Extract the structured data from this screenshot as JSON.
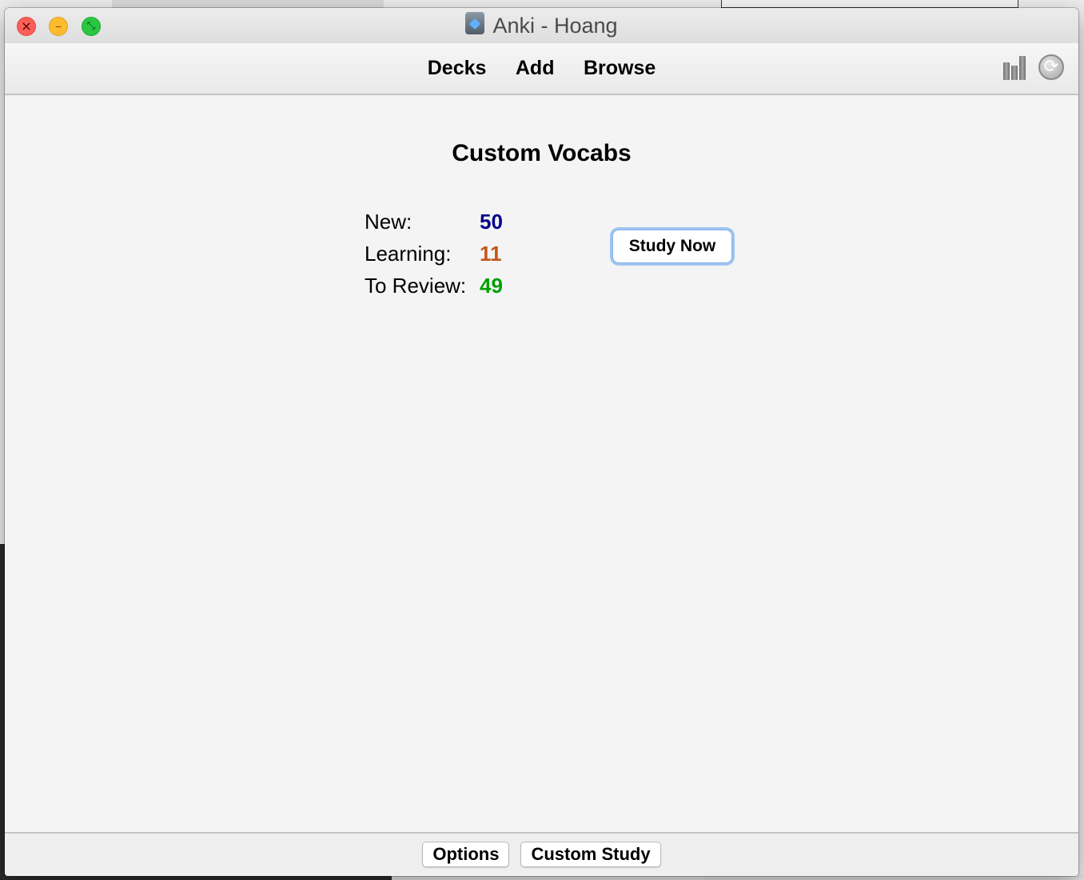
{
  "window": {
    "title": "Anki - Hoang",
    "controls": {
      "close": "×",
      "minimize": "–",
      "zoom": "⤡"
    }
  },
  "toolbar": {
    "nav": [
      {
        "label": "Decks"
      },
      {
        "label": "Add"
      },
      {
        "label": "Browse"
      }
    ],
    "icons": [
      "stats-icon",
      "sync-icon"
    ]
  },
  "overview": {
    "deck_name": "Custom Vocabs",
    "counts": [
      {
        "label": "New:",
        "value": "50",
        "color": "#00008b"
      },
      {
        "label": "Learning:",
        "value": "11",
        "color": "#c35617"
      },
      {
        "label": "To Review:",
        "value": "49",
        "color": "#00a000"
      }
    ],
    "study_button": "Study Now"
  },
  "bottom": {
    "options_label": "Options",
    "custom_study_label": "Custom Study"
  }
}
